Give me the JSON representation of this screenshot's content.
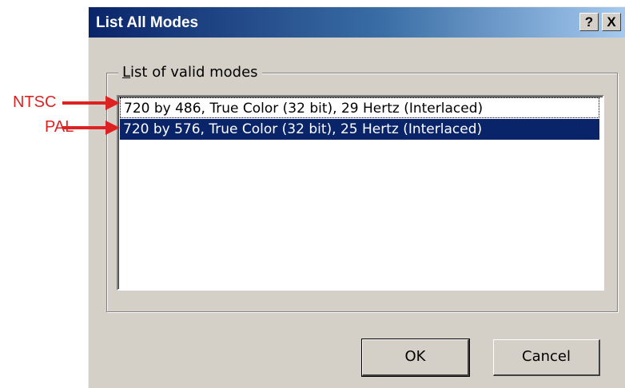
{
  "window": {
    "title": "List All Modes",
    "help_glyph": "?",
    "close_glyph": "X"
  },
  "group": {
    "label_accel": "L",
    "label_rest": "ist of valid modes"
  },
  "modes": {
    "items": [
      "720 by 486, True Color (32 bit), 29 Hertz (Interlaced)",
      "720 by 576, True Color (32 bit), 25 Hertz (Interlaced)"
    ],
    "selected_index": 1
  },
  "buttons": {
    "ok": "OK",
    "cancel": "Cancel"
  },
  "annotations": {
    "ntsc": "NTSC",
    "pal": "PAL",
    "color": "#dd2222"
  },
  "colors": {
    "titlebar_start": "#0a246a",
    "titlebar_end": "#a6caf0",
    "selection": "#0a246a",
    "dialog_face": "#d4d0c8"
  },
  "icons": {
    "help": "help-icon",
    "close": "close-icon",
    "annotation_arrow": "arrow-right-icon"
  }
}
